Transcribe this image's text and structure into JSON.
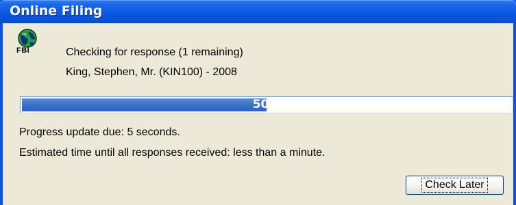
{
  "window": {
    "title": "Online Filing"
  },
  "icon": {
    "name": "globe-icon",
    "caption": "FBI",
    "colors": {
      "globe": "#1f9e3a",
      "land": "#0b2f8a"
    }
  },
  "status": {
    "checking_text": "Checking for response (1 remaining)",
    "client_text": "King, Stephen, Mr. (KIN100) - 2008"
  },
  "progress": {
    "percent": 50,
    "label": "50%"
  },
  "info": {
    "update_text": "Progress update due: 5 seconds.",
    "estimate_text": "Estimated time until all responses received: less than a minute."
  },
  "buttons": {
    "check_later": "Check Later"
  },
  "colors": {
    "titlebar": "#0a58e3",
    "dialog_bg": "#ece9d8",
    "progress_fill": "#3d74c9"
  }
}
